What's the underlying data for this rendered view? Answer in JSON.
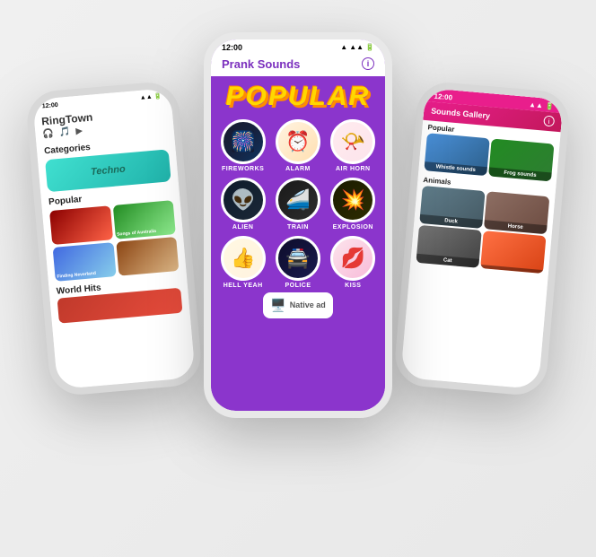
{
  "phones": {
    "left": {
      "status": "12:00",
      "appName": "RingTown",
      "sections": {
        "categories": "Categories",
        "techno": "Techno",
        "popular": "Popular",
        "worldHits": "World Hits"
      },
      "thumbTexts": [
        "",
        "Songs of Australia",
        "Finding Neverland",
        ""
      ]
    },
    "center": {
      "status": "12:00",
      "title": "Prank Sounds",
      "popularLabel": "POPULAR",
      "sounds": [
        {
          "label": "FIREWORKS",
          "emoji": "🎆"
        },
        {
          "label": "ALARM",
          "emoji": "⏰"
        },
        {
          "label": "AIR HORN",
          "emoji": "📯"
        },
        {
          "label": "ALIEN",
          "emoji": "👽"
        },
        {
          "label": "TRAIN",
          "emoji": "🚄"
        },
        {
          "label": "EXPLOSION",
          "emoji": "💥"
        },
        {
          "label": "HELL YEAH",
          "emoji": "👍"
        },
        {
          "label": "POLICE",
          "emoji": "🚔"
        },
        {
          "label": "KISS",
          "emoji": "💋"
        }
      ],
      "adText": "Native ad"
    },
    "right": {
      "status": "12:00",
      "headerTitle": "Sounds Gallery",
      "sections": {
        "popular": "Popular",
        "animals": "Animals"
      },
      "popularSounds": [
        {
          "label": "Whistle sounds"
        },
        {
          "label": "Frog sounds"
        }
      ],
      "animals": [
        {
          "label": "Duck"
        },
        {
          "label": "Horse"
        },
        {
          "label": "Cat"
        },
        {
          "label": ""
        }
      ]
    }
  }
}
